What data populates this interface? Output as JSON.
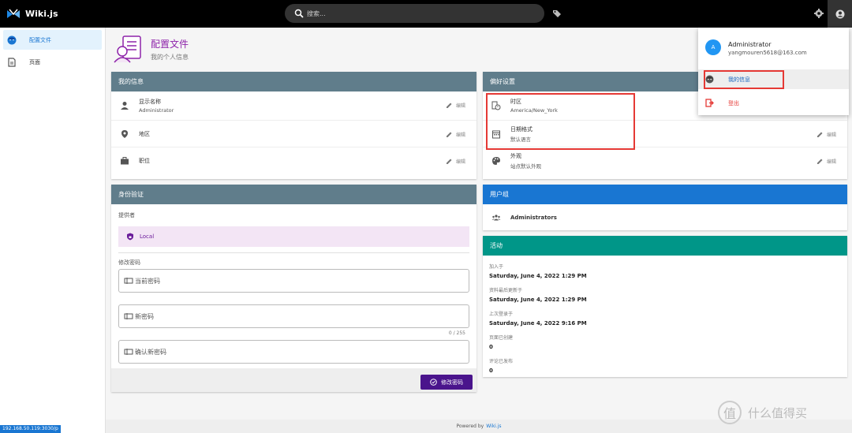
{
  "app": {
    "title": "Wiki.js"
  },
  "search": {
    "placeholder": "搜索..."
  },
  "sidebar": {
    "items": [
      {
        "label": "配置文件"
      },
      {
        "label": "页面"
      }
    ]
  },
  "ip_badge": "192.168.50.119:3030/p",
  "header": {
    "title": "配置文件",
    "subtitle": "我的个人信息"
  },
  "my_info": {
    "title": "我的信息",
    "rows": [
      {
        "label": "显示名称",
        "value": "Administrator",
        "edit": "编辑"
      },
      {
        "label": "地区",
        "edit": "编辑"
      },
      {
        "label": "职位",
        "edit": "编辑"
      }
    ]
  },
  "auth": {
    "title": "身份验证",
    "provider_label": "提供者",
    "provider": "Local",
    "change_pw_label": "修改密码",
    "current_pw_placeholder": "当前密码",
    "new_pw_placeholder": "新密码",
    "confirm_pw_placeholder": "确认新密码",
    "counter": "0 / 255",
    "change_btn": "修改密码"
  },
  "prefs": {
    "title": "偏好设置",
    "rows": [
      {
        "label": "时区",
        "value": "America/New_York"
      },
      {
        "label": "日期格式",
        "value": "默认语言",
        "edit": "编辑"
      },
      {
        "label": "外观",
        "value": "站点默认外观",
        "edit": "编辑"
      }
    ]
  },
  "groups": {
    "title": "用户组",
    "items": [
      "Administrators"
    ]
  },
  "activity": {
    "title": "活动",
    "items": [
      {
        "key": "加入于",
        "value": "Saturday, June 4, 2022 1:29 PM"
      },
      {
        "key": "资料最后更新于",
        "value": "Saturday, June 4, 2022 1:29 PM"
      },
      {
        "key": "上次登录于",
        "value": "Saturday, June 4, 2022 9:16 PM"
      },
      {
        "key": "页面已创建",
        "value": "0"
      },
      {
        "key": "评论已发布",
        "value": "0"
      }
    ]
  },
  "account_menu": {
    "avatar_letter": "A",
    "name": "Administrator",
    "email": "yangmouren5618@163.com",
    "my_info": "我的信息",
    "logout": "登出"
  },
  "footer": {
    "powered": "Powered by",
    "link": "Wiki.js"
  },
  "watermark": "什么值得买",
  "colors": {
    "info_header": "#607d8b",
    "groups_header": "#1976d2",
    "activity_header": "#009688",
    "accent_purple": "#8e24aa",
    "annotation_red": "#e53935"
  }
}
